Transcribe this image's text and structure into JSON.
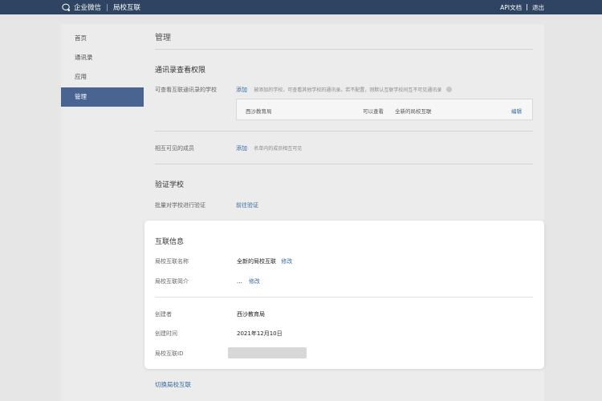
{
  "topbar": {
    "brand": "企业微信",
    "product": "局校互联",
    "links": [
      "API文档",
      "退出"
    ]
  },
  "sidebar": {
    "items": [
      {
        "label": "首页"
      },
      {
        "label": "通讯录"
      },
      {
        "label": "应用"
      },
      {
        "label": "管理",
        "active": true
      }
    ]
  },
  "main": {
    "title": "管理",
    "section1": {
      "title": "通讯录查看权限",
      "row_label": "可查看互联通讯录的学校",
      "add": "添加",
      "hint": "被添加的学校，可查看其他学校的通讯录。若不配置，则默认互联学校间互不可见通讯录",
      "entry": {
        "school": "西沙教育局",
        "permission": "可以查看",
        "target": "全新的局校互联",
        "action": "编辑"
      }
    },
    "section2": {
      "row_label": "相互可见的成员",
      "add": "添加",
      "hint": "名单内的成员相互可见"
    },
    "section3": {
      "title": "验证学校",
      "row_label": "批量对学校进行验证",
      "action": "前往验证"
    }
  },
  "info_card": {
    "title": "互联信息",
    "name_label": "局校互联名称",
    "name_value": "全新的局校互联",
    "name_edit": "修改",
    "intro_label": "局校互联简介",
    "intro_value": "...",
    "intro_edit": "修改",
    "creator_label": "创建者",
    "creator_value": "西沙教育局",
    "created_label": "创建时间",
    "created_value": "2021年12月10日",
    "id_label": "局校互联ID"
  },
  "footer_link": "切换局校互联",
  "colors": {
    "topbar": "#2f4462",
    "accent": "#4a6491",
    "link": "#356aa1"
  }
}
